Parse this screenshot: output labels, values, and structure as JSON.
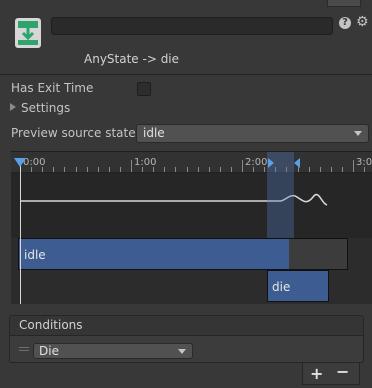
{
  "header": {
    "title": "AnyState -> die",
    "name_value": "",
    "help_icon": "?",
    "gear_icon": "⚙"
  },
  "settings": {
    "has_exit_time_label": "Has Exit Time",
    "has_exit_time_checked": false,
    "settings_label": "Settings",
    "preview_label": "Preview source state",
    "preview_value": "idle"
  },
  "timeline": {
    "ruler_labels": [
      "0:00",
      "1:00",
      "2:00",
      "3:00"
    ],
    "source_state": "idle",
    "destination_state": "die"
  },
  "conditions": {
    "title": "Conditions",
    "items": [
      {
        "parameter": "Die"
      }
    ],
    "add_label": "+",
    "remove_label": "−"
  },
  "colors": {
    "accent": "#5aa0e6",
    "state_bar": "#3d5d92"
  }
}
